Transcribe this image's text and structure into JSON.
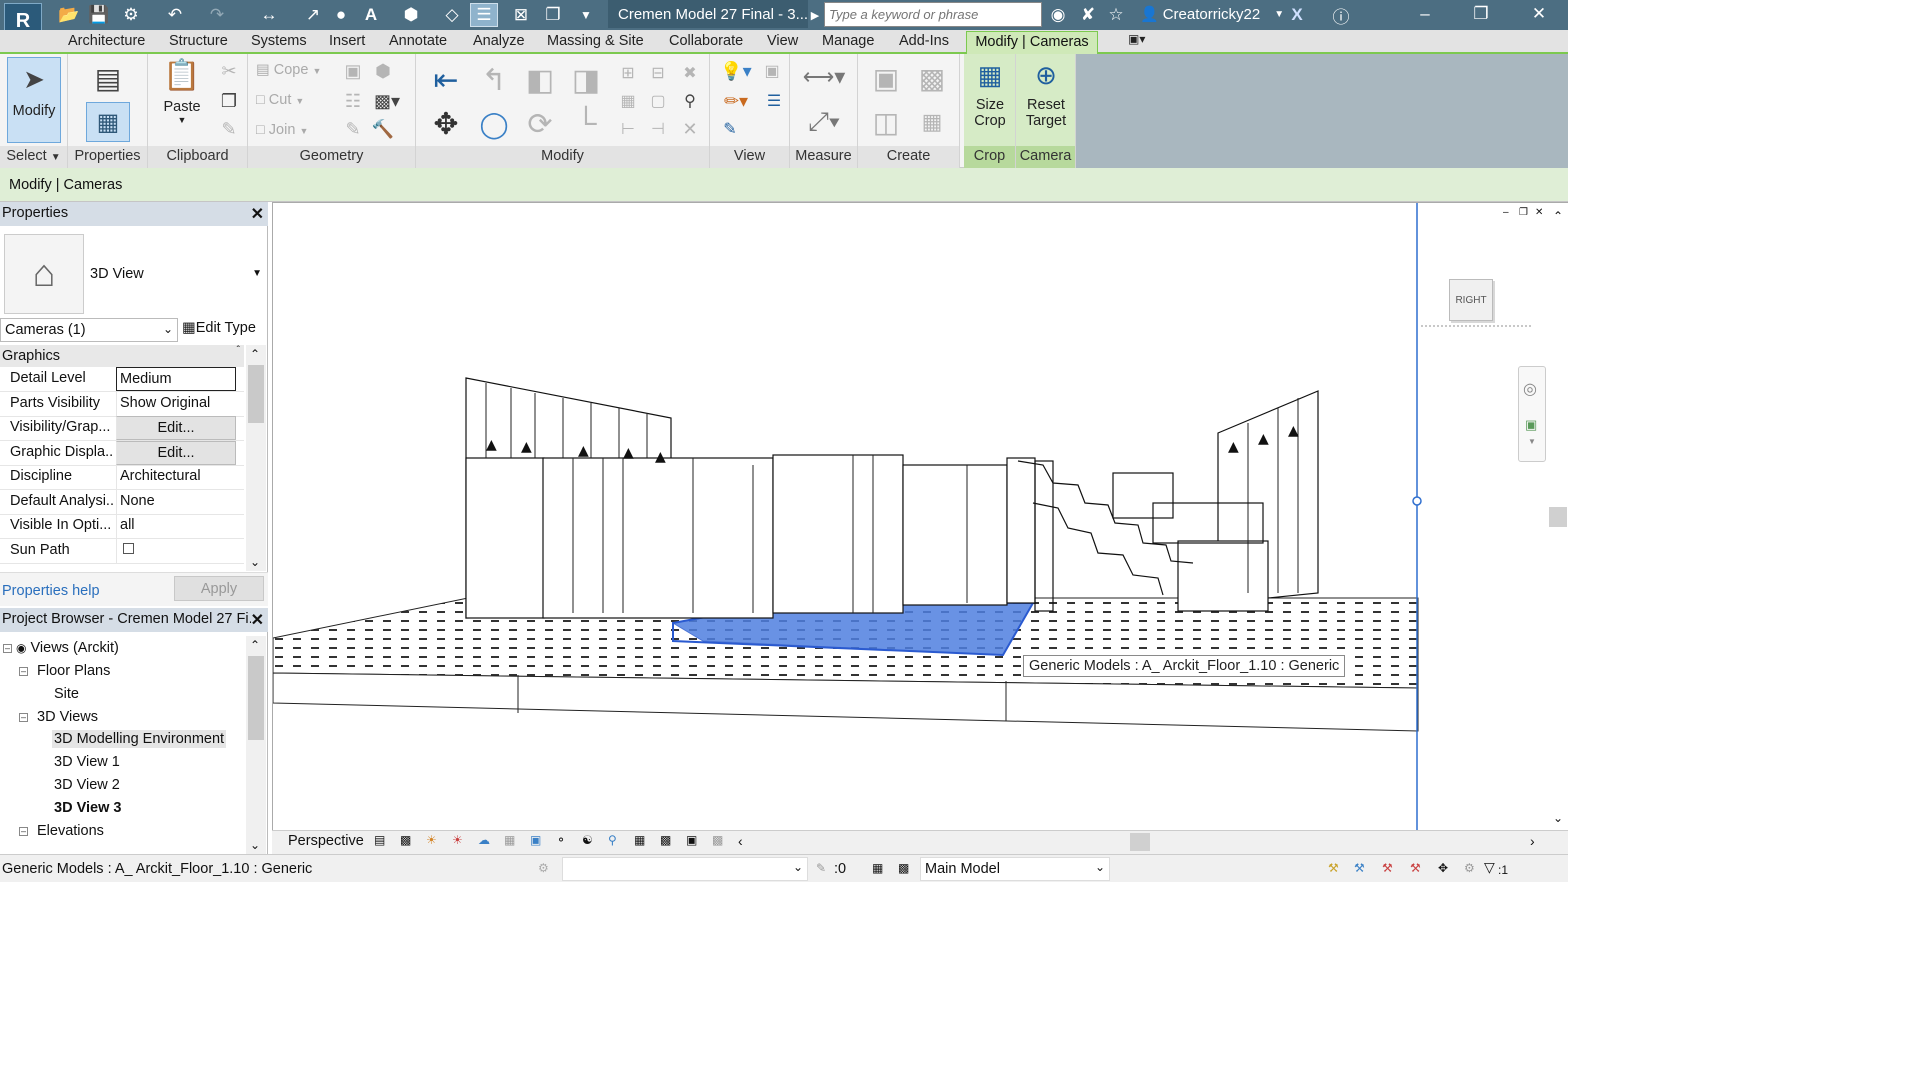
{
  "title_bar": {
    "document_title": "Cremen Model 27 Final - 3...",
    "search_placeholder": "Type a keyword or phrase",
    "username": "Creatorricky22",
    "app_logo_letter": "R"
  },
  "menu_tabs": [
    "Architecture",
    "Structure",
    "Systems",
    "Insert",
    "Annotate",
    "Analyze",
    "Massing & Site",
    "Collaborate",
    "View",
    "Manage",
    "Add-Ins"
  ],
  "active_tab": "Modify | Cameras",
  "ribbon": {
    "select": {
      "modify_label": "Modify",
      "panel_label": "Select"
    },
    "properties": {
      "panel_label": "Properties"
    },
    "clipboard": {
      "paste_label": "Paste",
      "panel_label": "Clipboard"
    },
    "geometry": {
      "cope_label": "Cope",
      "cut_label": "Cut",
      "join_label": "Join",
      "panel_label": "Geometry"
    },
    "modify": {
      "panel_label": "Modify"
    },
    "view": {
      "panel_label": "View"
    },
    "measure": {
      "panel_label": "Measure"
    },
    "create": {
      "panel_label": "Create"
    },
    "crop": {
      "size_crop_label_1": "Size",
      "size_crop_label_2": "Crop",
      "panel_label": "Crop"
    },
    "camera": {
      "reset_label_1": "Reset",
      "reset_label_2": "Target",
      "panel_label": "Camera"
    }
  },
  "context_bar": "Modify | Cameras",
  "properties_panel": {
    "header": "Properties",
    "type_name": "3D View",
    "instance_filter": "Cameras (1)",
    "edit_type_label": "Edit Type",
    "section_graphics": "Graphics",
    "rows": [
      {
        "key": "Detail Level",
        "value": "Medium"
      },
      {
        "key": "Parts Visibility",
        "value": "Show Original"
      },
      {
        "key": "Visibility/Grap...",
        "value": "Edit..."
      },
      {
        "key": "Graphic Displa...",
        "value": "Edit..."
      },
      {
        "key": "Discipline",
        "value": "Architectural"
      },
      {
        "key": "Default Analysi...",
        "value": "None"
      },
      {
        "key": "Visible In Opti...",
        "value": "all"
      },
      {
        "key": "Sun Path",
        "value": ""
      }
    ],
    "help_link": "Properties help",
    "apply_label": "Apply"
  },
  "project_browser": {
    "header": "Project Browser - Cremen Model 27 Fi...",
    "root": "Views (Arckit)",
    "floor_plans": "Floor Plans",
    "site": "Site",
    "views_3d": "3D Views",
    "view_items": [
      "3D Modelling Environment",
      "3D View 1",
      "3D View 2",
      "3D View 3"
    ],
    "elevations": "Elevations"
  },
  "viewport": {
    "viewcube_face": "RIGHT",
    "tooltip": "Generic Models : A_ Arckit_Floor_1.10 : Generic"
  },
  "view_control_bar": {
    "projection": "Perspective"
  },
  "status_bar": {
    "message": "Generic Models : A_ Arckit_Floor_1.10 : Generic",
    "zero_value": ":0",
    "model_dropdown": "Main Model",
    "filter_count": ":1"
  },
  "colors": {
    "titlebar": "#4c6e82",
    "contextual_green": "#7cc94f",
    "selection_blue": "#3a6bd6"
  }
}
